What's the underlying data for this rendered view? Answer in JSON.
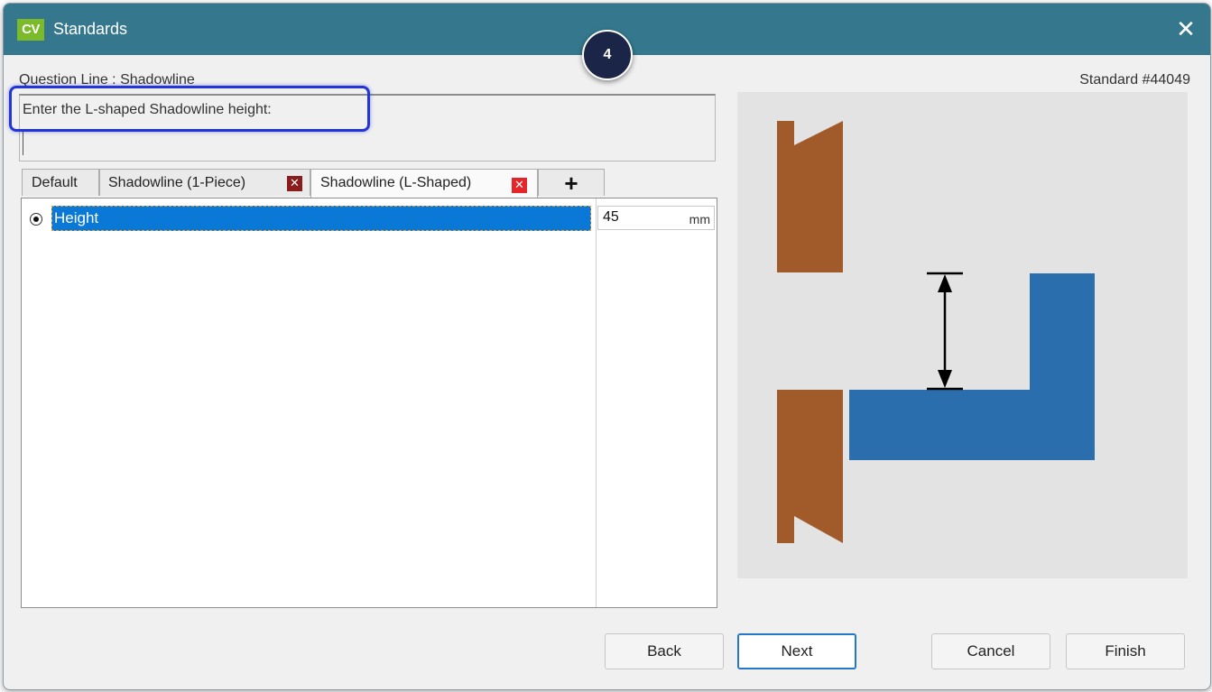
{
  "window": {
    "title": "Standards",
    "logo": "CV",
    "close_glyph": "✕"
  },
  "step_badge": "4",
  "header": {
    "question_line": "Question Line : Shadowline",
    "standard_number": "Standard #44049"
  },
  "prompt": {
    "text": "Enter the L-shaped Shadowline height:"
  },
  "tabs": [
    {
      "label": "Default",
      "closable": false,
      "active": false
    },
    {
      "label": "Shadowline (1-Piece)",
      "closable": true,
      "active": false
    },
    {
      "label": "Shadowline (L-Shaped)",
      "closable": true,
      "active": true
    }
  ],
  "tab_close_glyph": "✕",
  "tab_add_glyph": "+",
  "rows": [
    {
      "label": "Height",
      "value": "45",
      "unit": "mm",
      "selected": true
    }
  ],
  "diagram": {
    "icon": "shadowline-l-shaped-diagram",
    "colors": {
      "background": "#e3e3e3",
      "timber": "#a15a2a",
      "profile": "#2a6eae",
      "arrow": "#000000"
    }
  },
  "buttons": {
    "back": "Back",
    "next": "Next",
    "cancel": "Cancel",
    "finish": "Finish"
  },
  "colors": {
    "titlebar": "#35788d",
    "logo": "#7bbb2a",
    "selection": "#0a78d6",
    "highlight_ring": "#2335d6",
    "tab_close": "#cc1f1f"
  }
}
